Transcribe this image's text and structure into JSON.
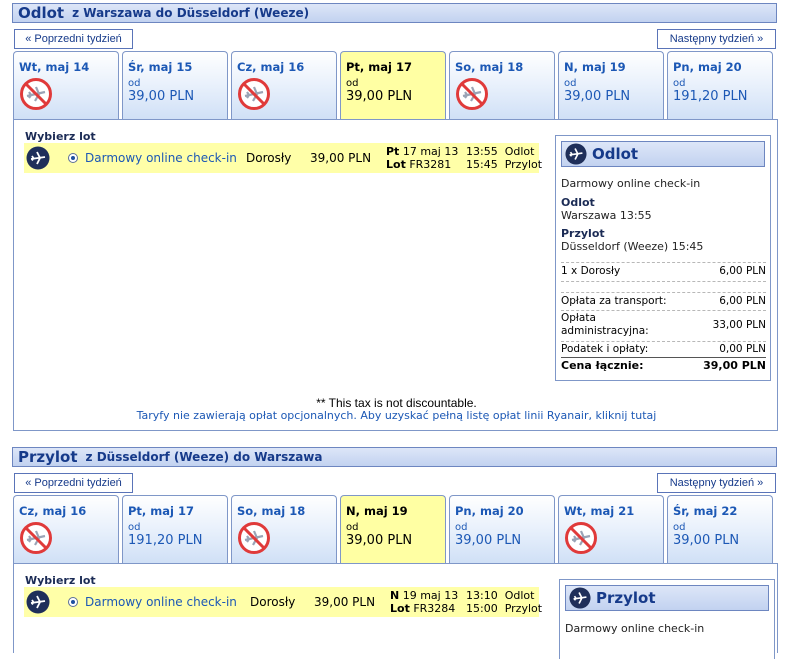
{
  "outbound": {
    "title": "Odlot",
    "route": "z Warszawa do Düsseldorf (Weeze)",
    "prev_week": "« Poprzedni tydzień",
    "next_week": "Następny tydzień »",
    "days": [
      {
        "label": "Wt, maj 14",
        "available": false,
        "od": "",
        "price": ""
      },
      {
        "label": "Śr, maj 15",
        "available": true,
        "od": "od",
        "price": "39,00 PLN"
      },
      {
        "label": "Cz, maj 16",
        "available": false,
        "od": "",
        "price": ""
      },
      {
        "label": "Pt, maj 17",
        "available": true,
        "od": "od",
        "price": "39,00 PLN",
        "selected": true
      },
      {
        "label": "So, maj 18",
        "available": false,
        "od": "",
        "price": ""
      },
      {
        "label": "N, maj 19",
        "available": true,
        "od": "od",
        "price": "39,00 PLN"
      },
      {
        "label": "Pn, maj 20",
        "available": true,
        "od": "od",
        "price": "191,20 PLN"
      }
    ],
    "choose_label": "Wybierz lot",
    "flight": {
      "fare_name": "Darmowy online check-in",
      "passenger": "Dorosły",
      "price": "39,00 PLN",
      "day_abbr": "Pt",
      "date": "17 maj 13",
      "lot_label": "Lot",
      "flight_no": "FR3281",
      "dep_time": "13:55",
      "dep_word": "Odlot",
      "arr_time": "15:45",
      "arr_word": "Przylot"
    },
    "summary": {
      "title": "Odlot",
      "fare": "Darmowy online check-in",
      "odlot_label": "Odlot",
      "odlot_value": "Warszawa 13:55",
      "przylot_label": "Przylot",
      "przylot_value": "Düsseldorf (Weeze) 15:45",
      "pax_label": "1 x Dorosły",
      "pax_value": "6,00 PLN",
      "transport_label": "Opłata za transport:",
      "transport_value": "6,00 PLN",
      "admin_label_1": "Opłata",
      "admin_label_2": "administracyjna:",
      "admin_value": "33,00 PLN",
      "tax_label": "Podatek i opłaty:",
      "tax_value": "0,00 PLN",
      "total_label": "Cena łącznie:",
      "total_value": "39,00 PLN"
    },
    "tax_note": "** This tax is not discountable.",
    "fees_note": "Taryfy nie zawierają opłat opcjonalnych. Aby uzyskać pełną listę opłat linii Ryanair, kliknij tutaj"
  },
  "return": {
    "title": "Przylot",
    "route": "z Düsseldorf (Weeze) do Warszawa",
    "prev_week": "« Poprzedni tydzień",
    "next_week": "Następny tydzień »",
    "days": [
      {
        "label": "Cz, maj 16",
        "available": false,
        "od": "",
        "price": ""
      },
      {
        "label": "Pt, maj 17",
        "available": true,
        "od": "od",
        "price": "191,20 PLN"
      },
      {
        "label": "So, maj 18",
        "available": false,
        "od": "",
        "price": ""
      },
      {
        "label": "N, maj 19",
        "available": true,
        "od": "od",
        "price": "39,00 PLN",
        "selected": true
      },
      {
        "label": "Pn, maj 20",
        "available": true,
        "od": "od",
        "price": "39,00 PLN"
      },
      {
        "label": "Wt, maj 21",
        "available": false,
        "od": "",
        "price": ""
      },
      {
        "label": "Śr, maj 22",
        "available": true,
        "od": "od",
        "price": "39,00 PLN"
      }
    ],
    "choose_label": "Wybierz lot",
    "flight": {
      "fare_name": "Darmowy online check-in",
      "passenger": "Dorosły",
      "price": "39,00 PLN",
      "day_abbr": "N",
      "date": "19 maj 13",
      "lot_label": "Lot",
      "flight_no": "FR3284",
      "dep_time": "13:10",
      "dep_word": "Odlot",
      "arr_time": "15:00",
      "arr_word": "Przylot"
    },
    "summary": {
      "title": "Przylot",
      "fare": "Darmowy online check-in"
    }
  },
  "colors": {
    "header_text": "#163a8a",
    "link_blue": "#1c58b5",
    "selected_day_bg": "#ffffa3",
    "flight_row_bg": "#ffffa8",
    "no_flight_red": "#e03a3a"
  }
}
